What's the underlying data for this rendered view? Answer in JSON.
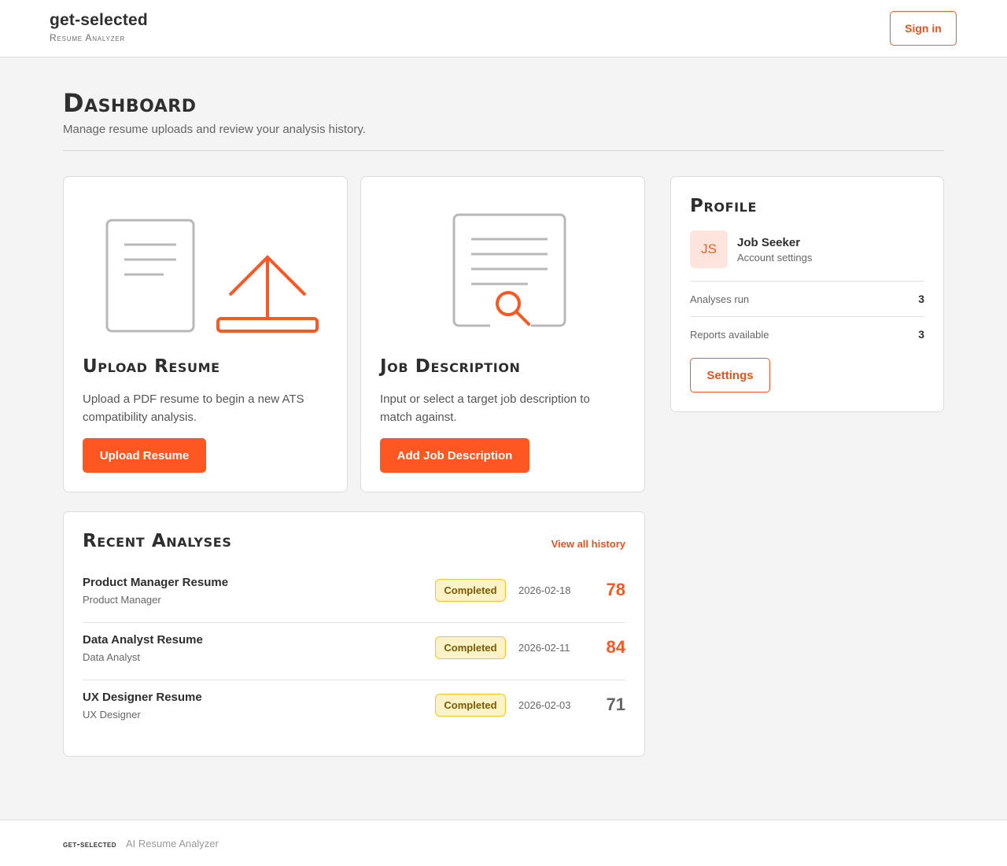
{
  "header": {
    "brand": "get-selected",
    "tagline": "Resume Analyzer",
    "signin_label": "Sign in"
  },
  "page": {
    "title": "Dashboard",
    "subtitle": "Manage resume uploads and review your analysis history."
  },
  "upload_card": {
    "title": "Upload Resume",
    "description": "Upload a PDF resume to begin a new ATS compatibility analysis.",
    "button_label": "Upload Resume",
    "icons": [
      "document-icon",
      "upload-icon"
    ]
  },
  "job_card": {
    "title": "Job Description",
    "description": "Input or select a target job description to match against.",
    "button_label": "Add Job Description",
    "icons": [
      "document-search-icon"
    ]
  },
  "profile": {
    "title": "Profile",
    "initials": "JS",
    "name": "Job Seeker",
    "account_link": "Account settings",
    "stats": [
      {
        "label": "Analyses run",
        "value": "3"
      },
      {
        "label": "Reports available",
        "value": "3"
      }
    ],
    "settings_label": "Settings"
  },
  "recent": {
    "title": "Recent Analyses",
    "view_all_label": "View all history",
    "items": [
      {
        "title": "Product Manager Resume",
        "role": "Product Manager",
        "status": "Completed",
        "date": "2026-02-18",
        "score": "78",
        "score_color": "#ff5722"
      },
      {
        "title": "Data Analyst Resume",
        "role": "Data Analyst",
        "status": "Completed",
        "date": "2026-02-11",
        "score": "84",
        "score_color": "#ff5722"
      },
      {
        "title": "UX Designer Resume",
        "role": "UX Designer",
        "status": "Completed",
        "date": "2026-02-03",
        "score": "71",
        "score_color": "#666666"
      }
    ]
  },
  "footer": {
    "brand": "get-selected",
    "text": "AI Resume Analyzer"
  },
  "colors": {
    "accent": "#ff5722",
    "badge_bg": "#fdf3c6",
    "badge_border": "#f0c42c",
    "page_bg": "#f4f4f4"
  }
}
